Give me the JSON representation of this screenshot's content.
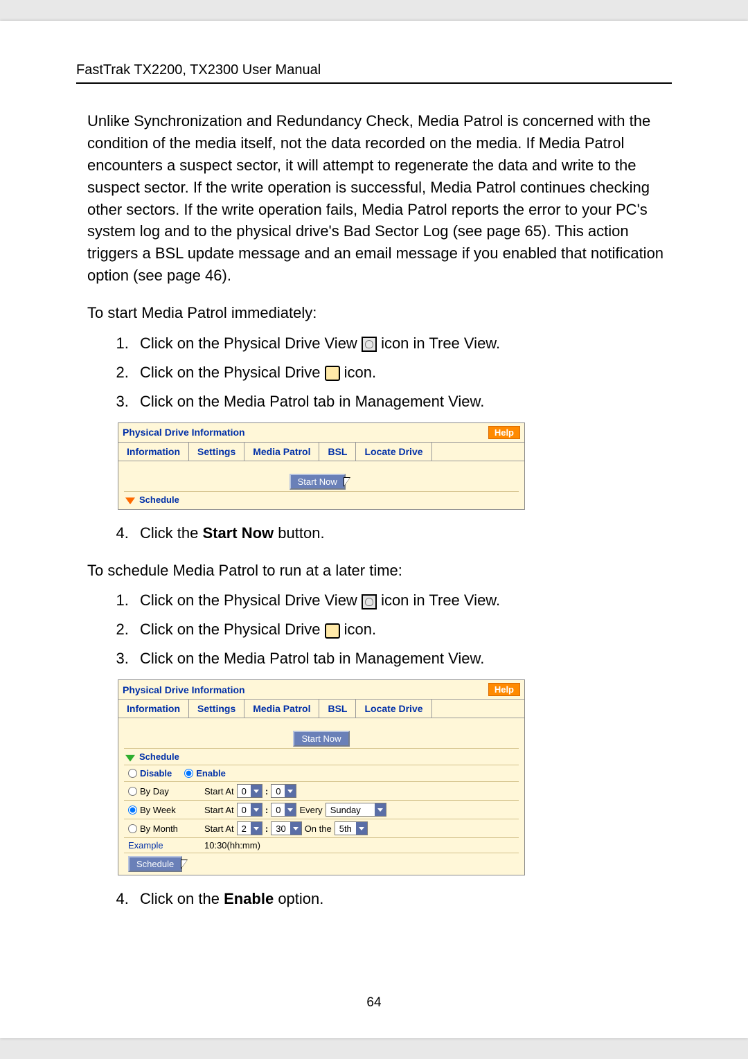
{
  "header": {
    "title": "FastTrak TX2200, TX2300 User Manual"
  },
  "para1": "Unlike Synchronization and Redundancy Check, Media Patrol is concerned with the condition of the media itself, not the data recorded on the media. If Media Patrol encounters a suspect sector, it will attempt to regenerate the data and write to the suspect sector. If the write operation is successful, Media Patrol continues checking other sectors. If the write operation fails, Media Patrol reports the error to your PC's system log and to the physical drive's Bad Sector Log (see page 65). This action triggers a BSL update message and an email message if you enabled that notification option (see page 46).",
  "para2": "To start Media Patrol immediately:",
  "steps1": {
    "s1a": "Click on the Physical Drive View ",
    "s1b": " icon in Tree View.",
    "s2a": "Click on the Physical Drive ",
    "s2b": " icon.",
    "s3": "Click on the Media Patrol tab in Management View.",
    "s4a": "Click the ",
    "s4b": "Start Now",
    "s4c": " button."
  },
  "para3": "To schedule Media Patrol to run at a later time:",
  "steps2": {
    "s1a": "Click on the Physical Drive View ",
    "s1b": " icon in Tree View.",
    "s2a": "Click on the Physical Drive ",
    "s2b": " icon.",
    "s3": "Click on the Media Patrol tab in Management View.",
    "s4a": "Click on the ",
    "s4b": "Enable",
    "s4c": " option."
  },
  "panel": {
    "title": "Physical Drive Information",
    "help": "Help",
    "tabs": [
      "Information",
      "Settings",
      "Media Patrol",
      "BSL",
      "Locate Drive"
    ],
    "start_now": "Start Now",
    "schedule_label": "Schedule",
    "disable": "Disable",
    "enable": "Enable",
    "by_day": "By Day",
    "by_week": "By Week",
    "by_month": "By Month",
    "start_at": "Start At",
    "every": "Every",
    "on_the": "On the",
    "day_hour": "0",
    "day_min": "0",
    "week_hour": "0",
    "week_min": "0",
    "week_day": "Sunday",
    "month_hour": "2",
    "month_min": "30",
    "month_day": "5th",
    "example_label": "Example",
    "example_value": "10:30(hh:mm)",
    "schedule_btn": "Schedule"
  },
  "page_number": "64"
}
